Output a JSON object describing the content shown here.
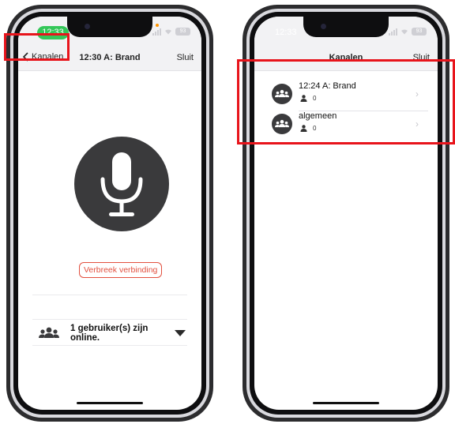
{
  "left_phone": {
    "status": {
      "time": "12:33",
      "battery": "93"
    },
    "nav": {
      "back_label": "Kanalen",
      "title": "12:30 A: Brand",
      "close_label": "Sluit"
    },
    "disconnect_label": "Verbreek verbinding",
    "users_online_label": "1 gebruiker(s) zijn online."
  },
  "right_phone": {
    "status": {
      "time": "12:33",
      "battery": "93"
    },
    "nav": {
      "title": "Kanalen",
      "close_label": "Sluit"
    },
    "channels": [
      {
        "name": "12:24 A: Brand",
        "user_count": "0"
      },
      {
        "name": "algemeen",
        "user_count": "0"
      }
    ]
  },
  "colors": {
    "highlight": "#e8141b",
    "accent_red": "#e2503f",
    "status_green": "#34c759",
    "icon_dark": "#3a3a3c"
  },
  "icons": [
    "microphone-icon",
    "chevron-left-icon",
    "users-group-icon",
    "caret-down-icon",
    "user-icon",
    "chevron-right-icon"
  ]
}
